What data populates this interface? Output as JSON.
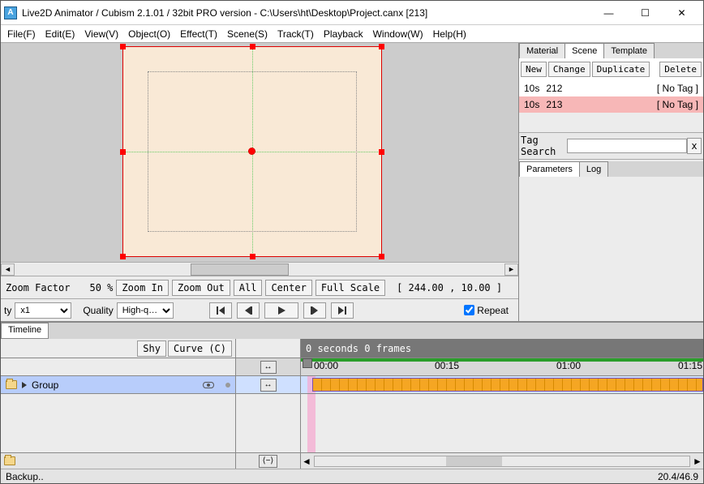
{
  "window": {
    "title": "Live2D Animator / Cubism 2.1.01  / 32bit  PRO version - C:\\Users\\ht\\Desktop\\Project.canx  [213]",
    "appicon_letter": "A"
  },
  "menu": {
    "file": "File(F)",
    "edit": "Edit(E)",
    "view": "View(V)",
    "object": "Object(O)",
    "effect": "Effect(T)",
    "scene": "Scene(S)",
    "track": "Track(T)",
    "playback": "Playback",
    "window": "Window(W)",
    "help": "Help(H)"
  },
  "zoom": {
    "label": "Zoom Factor",
    "percent": "50 %",
    "zoom_in": "Zoom In",
    "zoom_out": "Zoom Out",
    "all": "All",
    "center": "Center",
    "full_scale": "Full Scale",
    "coords": "[  244.00 ,   10.00 ]"
  },
  "play": {
    "ty_label": "ty",
    "ty_value": "x1",
    "quality_label": "Quality",
    "quality_value": "High-q…",
    "repeat_label": "Repeat",
    "repeat_checked": true
  },
  "sidebar": {
    "tabs": {
      "material": "Material",
      "scene": "Scene",
      "template": "Template"
    },
    "buttons": {
      "new": "New",
      "change": "Change",
      "duplicate": "Duplicate",
      "delete": "Delete"
    },
    "scenes": [
      {
        "dur": "10s",
        "id": "212",
        "tag": "[ No Tag ]",
        "selected": false
      },
      {
        "dur": "10s",
        "id": "213",
        "tag": "[ No Tag ]",
        "selected": true
      }
    ],
    "tag_search_label": "Tag Search",
    "tag_search_x": "x",
    "param_tabs": {
      "parameters": "Parameters",
      "log": "Log"
    }
  },
  "timeline": {
    "tab": "Timeline",
    "shy": "Shy",
    "curve": "Curve (C)",
    "time_text": "0 seconds  0 frames",
    "ruler": [
      "00:00",
      "00:15",
      "01:00",
      "01:15"
    ],
    "track_name": "Group",
    "nav_symbol": "⟨−⟩",
    "arrow_symbol": "↔"
  },
  "status": {
    "left": "Backup..",
    "right": "20.4/46.9"
  }
}
